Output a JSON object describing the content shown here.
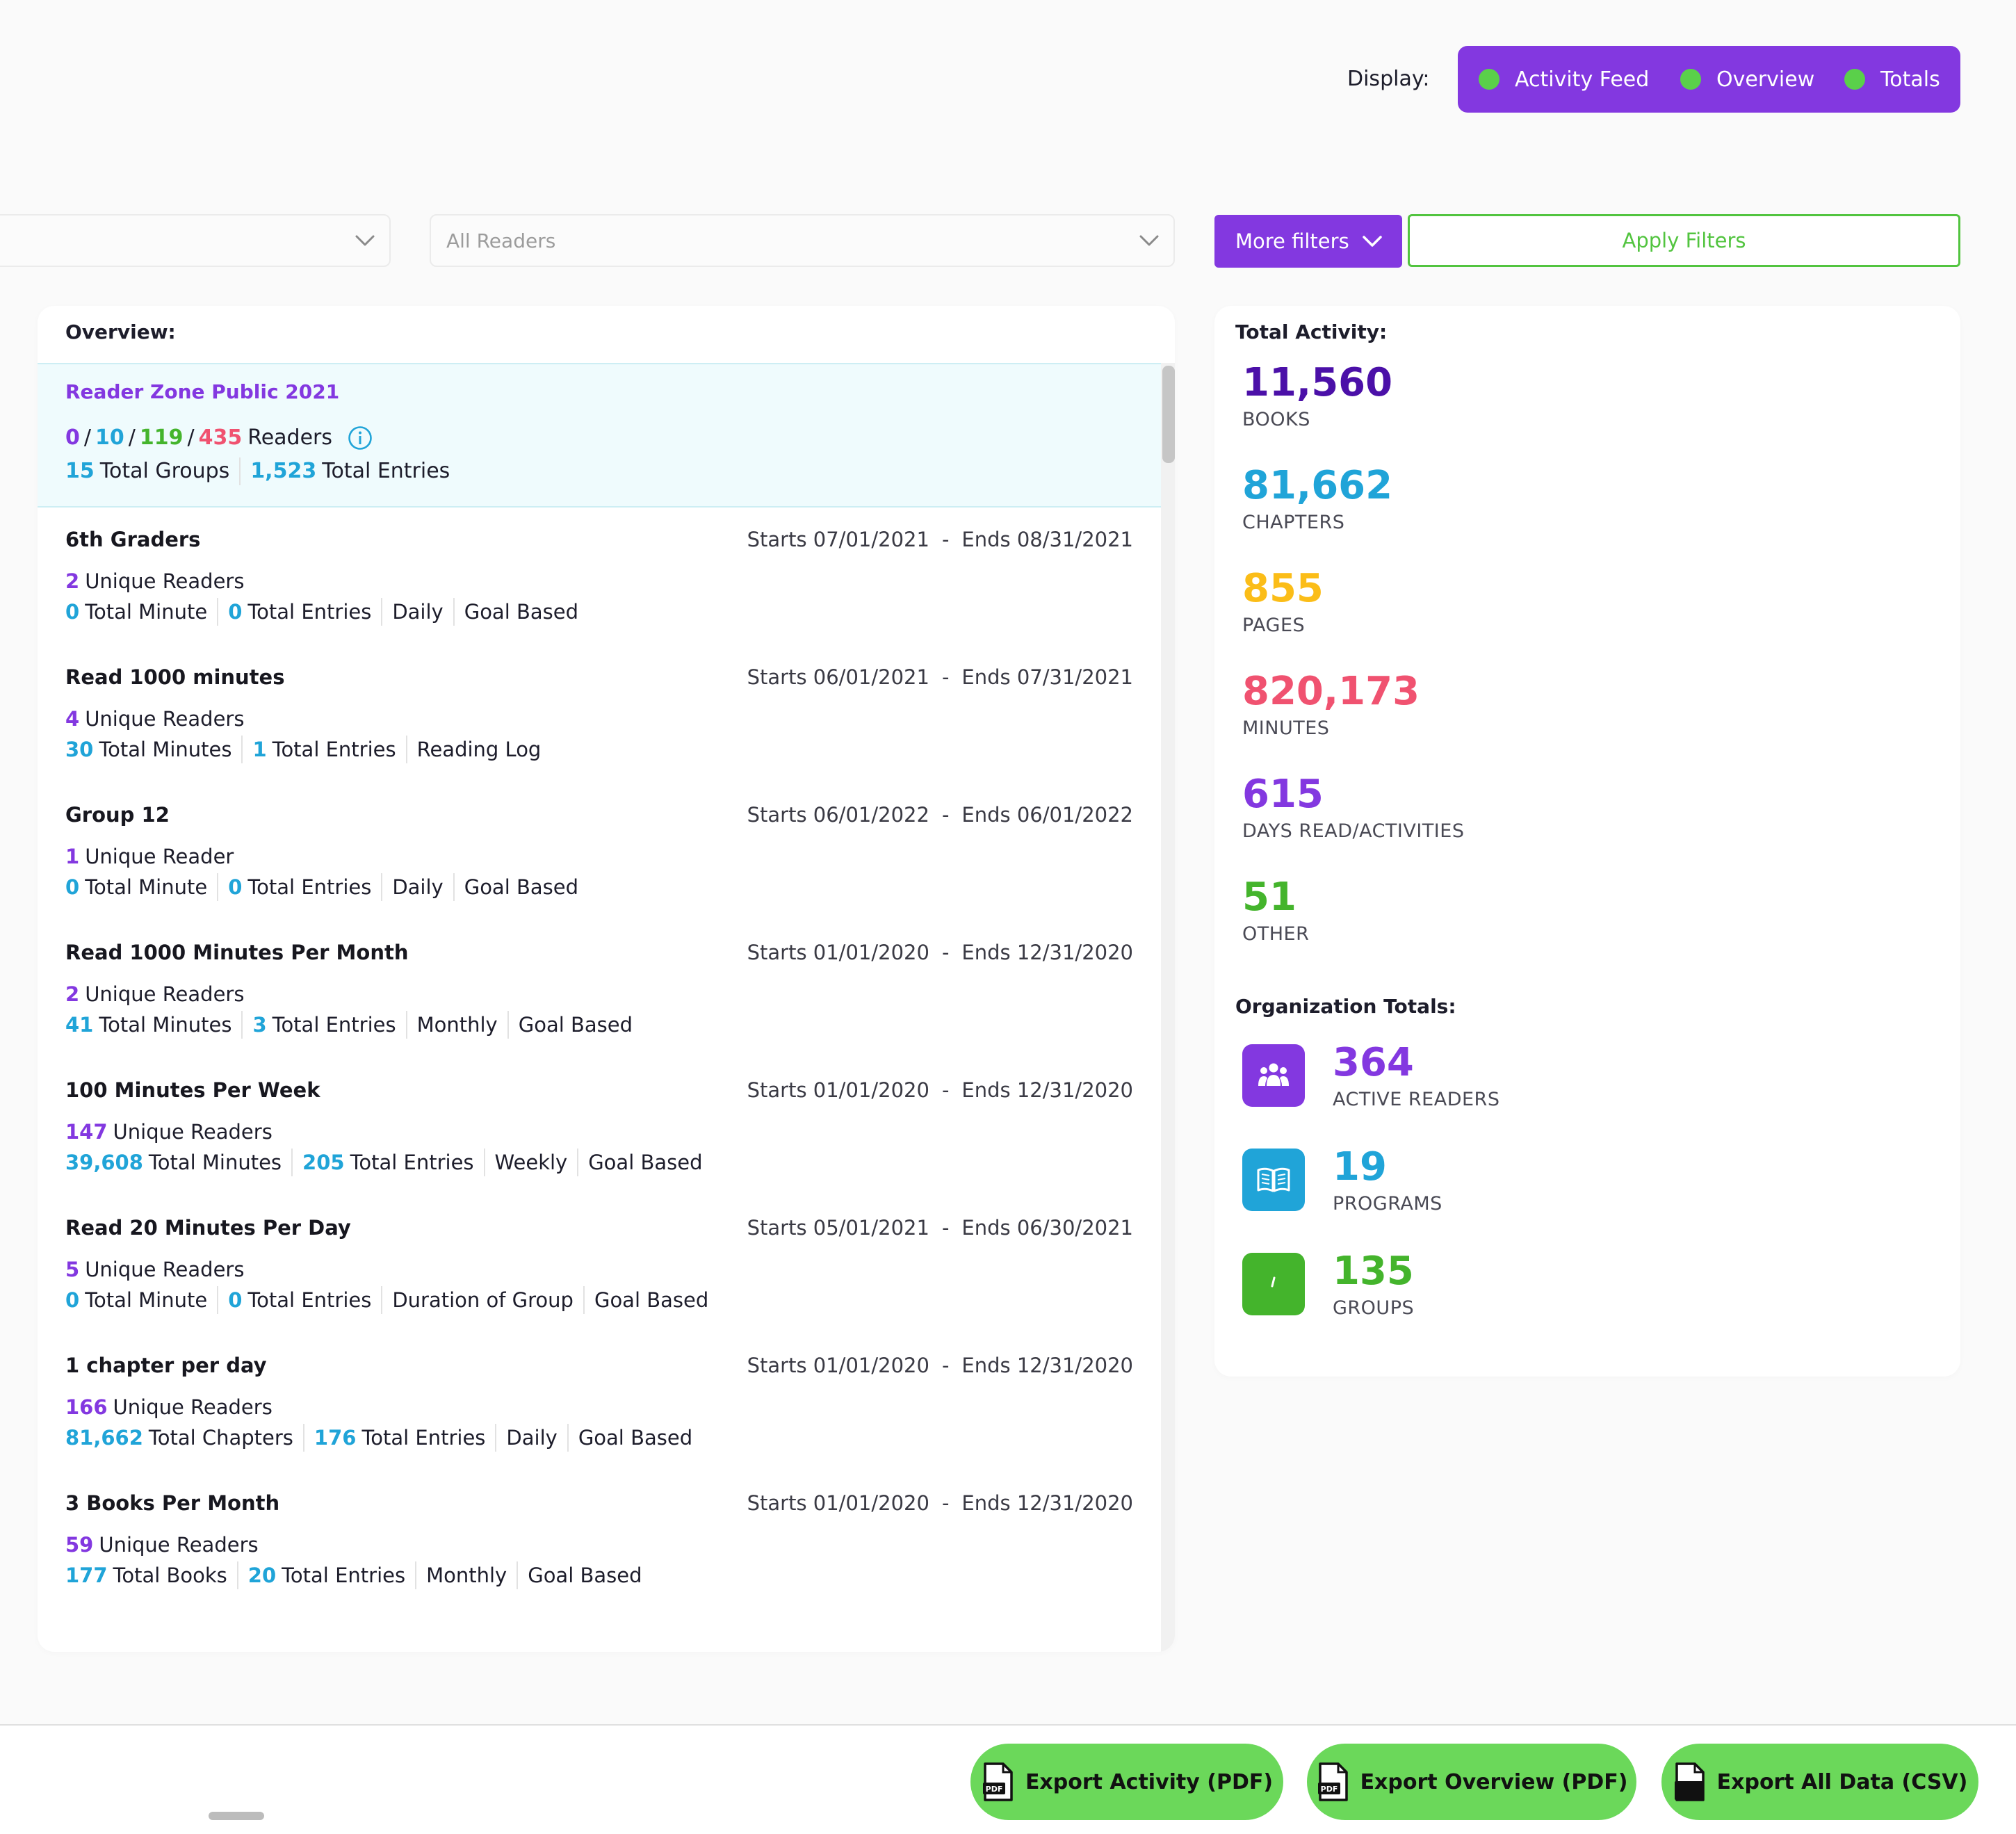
{
  "display": {
    "label": "Display:",
    "options": [
      {
        "label": "Activity Feed",
        "enabled": true
      },
      {
        "label": "Overview",
        "enabled": true
      },
      {
        "label": "Totals",
        "enabled": true
      }
    ],
    "dot_color": "#5ad04a",
    "accent": "#8338e0"
  },
  "filters": {
    "first_select_value": "",
    "readers_placeholder": "All Readers",
    "more_filters_label": "More filters",
    "apply_label": "Apply Filters"
  },
  "overview": {
    "title": "Overview:",
    "org": {
      "name": "Reader Zone Public 2021",
      "counts": [
        "0",
        "10",
        "119",
        "435"
      ],
      "counts_suffix": "Readers",
      "groups_value": "15",
      "groups_label": "Total Groups",
      "entries_value": "1,523",
      "entries_label": "Total Entries"
    },
    "groups": [
      {
        "name": "6th Graders",
        "starts": "Starts 07/01/2021",
        "ends": "Ends 08/31/2021",
        "readers_value": "2",
        "readers_label": "Unique Readers",
        "metric_value": "0",
        "metric_label": "Total Minute",
        "entries_value": "0",
        "entries_label": "Total Entries",
        "period": "Daily",
        "type": "Goal Based"
      },
      {
        "name": "Read 1000 minutes",
        "starts": "Starts 06/01/2021",
        "ends": "Ends 07/31/2021",
        "readers_value": "4",
        "readers_label": "Unique Readers",
        "metric_value": "30",
        "metric_label": "Total Minutes",
        "entries_value": "1",
        "entries_label": "Total Entries",
        "period": "Reading Log",
        "type": ""
      },
      {
        "name": "Group 12",
        "starts": "Starts 06/01/2022",
        "ends": "Ends 06/01/2022",
        "readers_value": "1",
        "readers_label": "Unique Reader",
        "metric_value": "0",
        "metric_label": "Total Minute",
        "entries_value": "0",
        "entries_label": "Total Entries",
        "period": "Daily",
        "type": "Goal Based"
      },
      {
        "name": "Read 1000 Minutes Per Month",
        "starts": "Starts 01/01/2020",
        "ends": "Ends 12/31/2020",
        "readers_value": "2",
        "readers_label": "Unique Readers",
        "metric_value": "41",
        "metric_label": "Total Minutes",
        "entries_value": "3",
        "entries_label": "Total Entries",
        "period": "Monthly",
        "type": "Goal Based"
      },
      {
        "name": "100 Minutes Per Week",
        "starts": "Starts 01/01/2020",
        "ends": "Ends 12/31/2020",
        "readers_value": "147",
        "readers_label": "Unique Readers",
        "metric_value": "39,608",
        "metric_label": "Total Minutes",
        "entries_value": "205",
        "entries_label": "Total Entries",
        "period": "Weekly",
        "type": "Goal Based"
      },
      {
        "name": "Read 20 Minutes Per Day",
        "starts": "Starts 05/01/2021",
        "ends": "Ends 06/30/2021",
        "readers_value": "5",
        "readers_label": "Unique Readers",
        "metric_value": "0",
        "metric_label": "Total Minute",
        "entries_value": "0",
        "entries_label": "Total Entries",
        "period": "Duration of Group",
        "type": "Goal Based"
      },
      {
        "name": "1 chapter per day",
        "starts": "Starts 01/01/2020",
        "ends": "Ends 12/31/2020",
        "readers_value": "166",
        "readers_label": "Unique Readers",
        "metric_value": "81,662",
        "metric_label": "Total Chapters",
        "entries_value": "176",
        "entries_label": "Total Entries",
        "period": "Daily",
        "type": "Goal Based"
      },
      {
        "name": "3 Books Per Month",
        "starts": "Starts 01/01/2020",
        "ends": "Ends 12/31/2020",
        "readers_value": "59",
        "readers_label": "Unique Readers",
        "metric_value": "177",
        "metric_label": "Total Books",
        "entries_value": "20",
        "entries_label": "Total Entries",
        "period": "Monthly",
        "type": "Goal Based"
      }
    ],
    "date_separator": "-"
  },
  "totals": {
    "title": "Total Activity:",
    "stats": [
      {
        "value": "11,560",
        "label": "BOOKS",
        "color": "#4b10a8"
      },
      {
        "value": "81,662",
        "label": "CHAPTERS",
        "color": "#20a4d8"
      },
      {
        "value": "855",
        "label": "PAGES",
        "color": "#fbbd18"
      },
      {
        "value": "820,173",
        "label": "MINUTES",
        "color": "#f05270"
      },
      {
        "value": "615",
        "label": "DAYS READ/ACTIVITIES",
        "color": "#8338e0"
      },
      {
        "value": "51",
        "label": "OTHER",
        "color": "#44b42c"
      }
    ],
    "org_title": "Organization Totals:",
    "org_stats": [
      {
        "value": "364",
        "label": "ACTIVE READERS",
        "color": "#8338e0",
        "icon": "users-icon"
      },
      {
        "value": "19",
        "label": "PROGRAMS",
        "color": "#20a4d8",
        "icon": "book-icon"
      },
      {
        "value": "135",
        "label": "GROUPS",
        "color": "#44b42c",
        "icon": "group-icon"
      }
    ]
  },
  "footer": {
    "export_activity": "Export Activity (PDF)",
    "export_overview": "Export Overview (PDF)",
    "export_all": "Export All Data (CSV)",
    "button_color": "#6bd85a"
  }
}
